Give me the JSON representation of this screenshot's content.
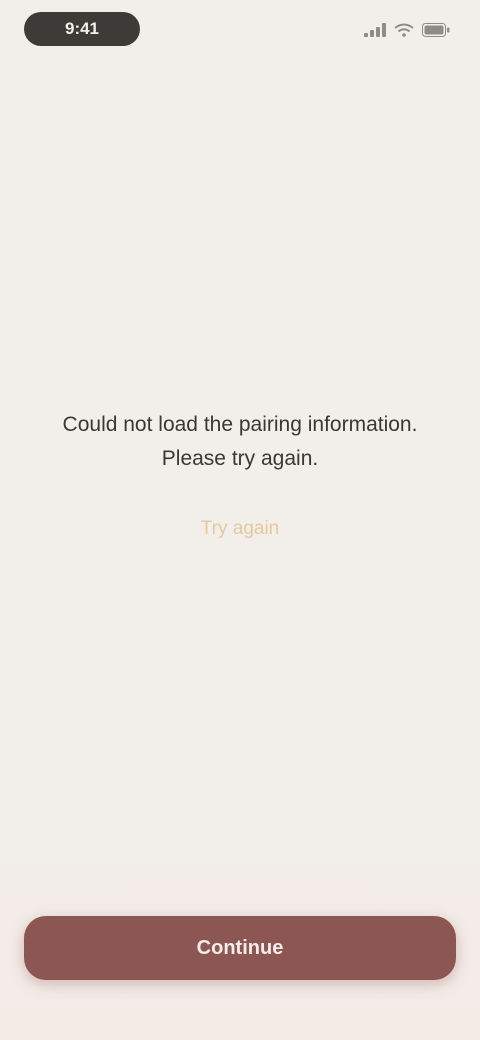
{
  "status_bar": {
    "time": "9:41",
    "icons": [
      "signal-icon",
      "wifi-icon",
      "battery-icon"
    ]
  },
  "message": {
    "text": "Could not load the pairing information. Please try again.",
    "retry_label": "Try again"
  },
  "footer": {
    "button_label": "Continue"
  },
  "colors": {
    "background": "#f2efeb",
    "accent": "#e3c99d",
    "button": "#8c5753"
  }
}
